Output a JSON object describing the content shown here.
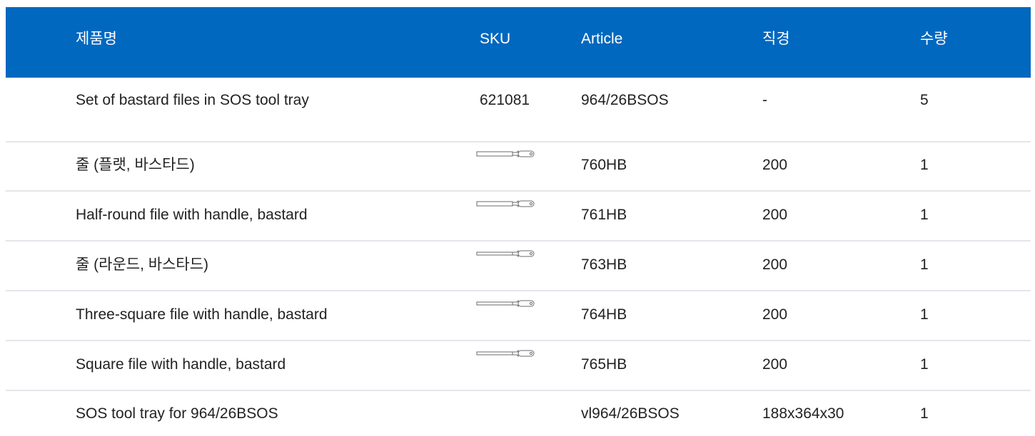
{
  "header": {
    "name": "제품명",
    "sku": "SKU",
    "article": "Article",
    "diameter": "직경",
    "quantity": "수량"
  },
  "rows": [
    {
      "name": "Set of bastard files in SOS tool tray",
      "sku": "621081",
      "article": "964/26BSOS",
      "diameter": "-",
      "quantity": "5",
      "icon": ""
    },
    {
      "name": "줄 (플랫, 바스타드)",
      "sku": "",
      "article": "760HB",
      "diameter": "200",
      "quantity": "1",
      "icon": "flat-file-icon"
    },
    {
      "name": "Half-round file with handle, bastard",
      "sku": "",
      "article": "761HB",
      "diameter": "200",
      "quantity": "1",
      "icon": "half-round-file-icon"
    },
    {
      "name": "줄 (라운드, 바스타드)",
      "sku": "",
      "article": "763HB",
      "diameter": "200",
      "quantity": "1",
      "icon": "round-file-icon"
    },
    {
      "name": "Three-square file with handle, bastard",
      "sku": "",
      "article": "764HB",
      "diameter": "200",
      "quantity": "1",
      "icon": "three-square-file-icon"
    },
    {
      "name": "Square file with handle, bastard",
      "sku": "",
      "article": "765HB",
      "diameter": "200",
      "quantity": "1",
      "icon": "square-file-icon"
    },
    {
      "name": "SOS tool tray for 964/26BSOS",
      "sku": "",
      "article": "vl964/26BSOS",
      "diameter": "188x364x30",
      "quantity": "1",
      "icon": ""
    }
  ],
  "colors": {
    "header_bg": "#0068bf",
    "header_text": "#ffffff",
    "divider": "#e3e6ea",
    "text": "#222222"
  }
}
